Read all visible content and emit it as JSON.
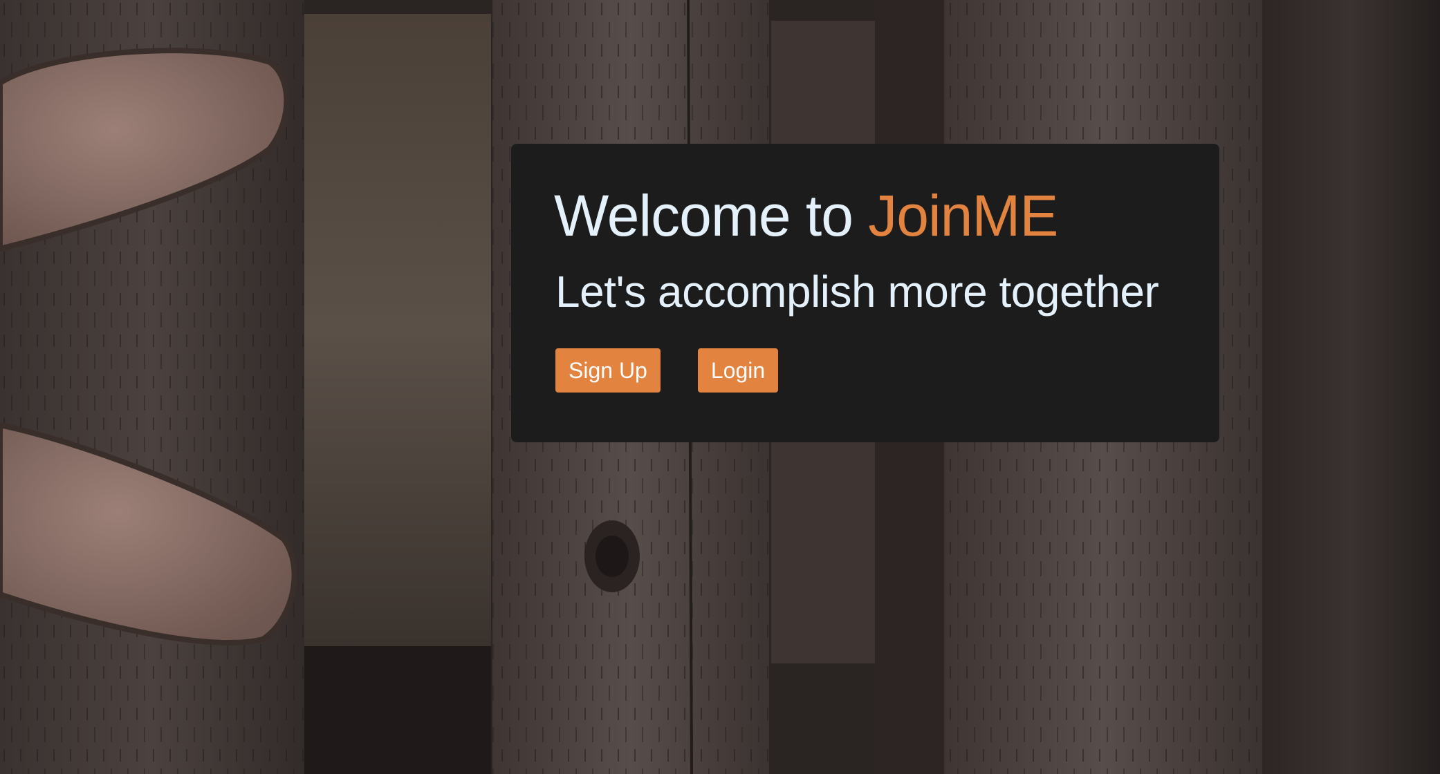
{
  "background": {
    "image": "weathered-wooden-planks-with-boots"
  },
  "hero": {
    "title_prefix": "Welcome to ",
    "brand_name": "JoinME",
    "subtitle": "Let's accomplish more together",
    "signup_label": "Sign Up",
    "login_label": "Login"
  },
  "colors": {
    "accent": "#e2843f",
    "card_background": "#1c1c1c",
    "heading_text": "#e4f1fa",
    "button_text": "#ffffff"
  }
}
